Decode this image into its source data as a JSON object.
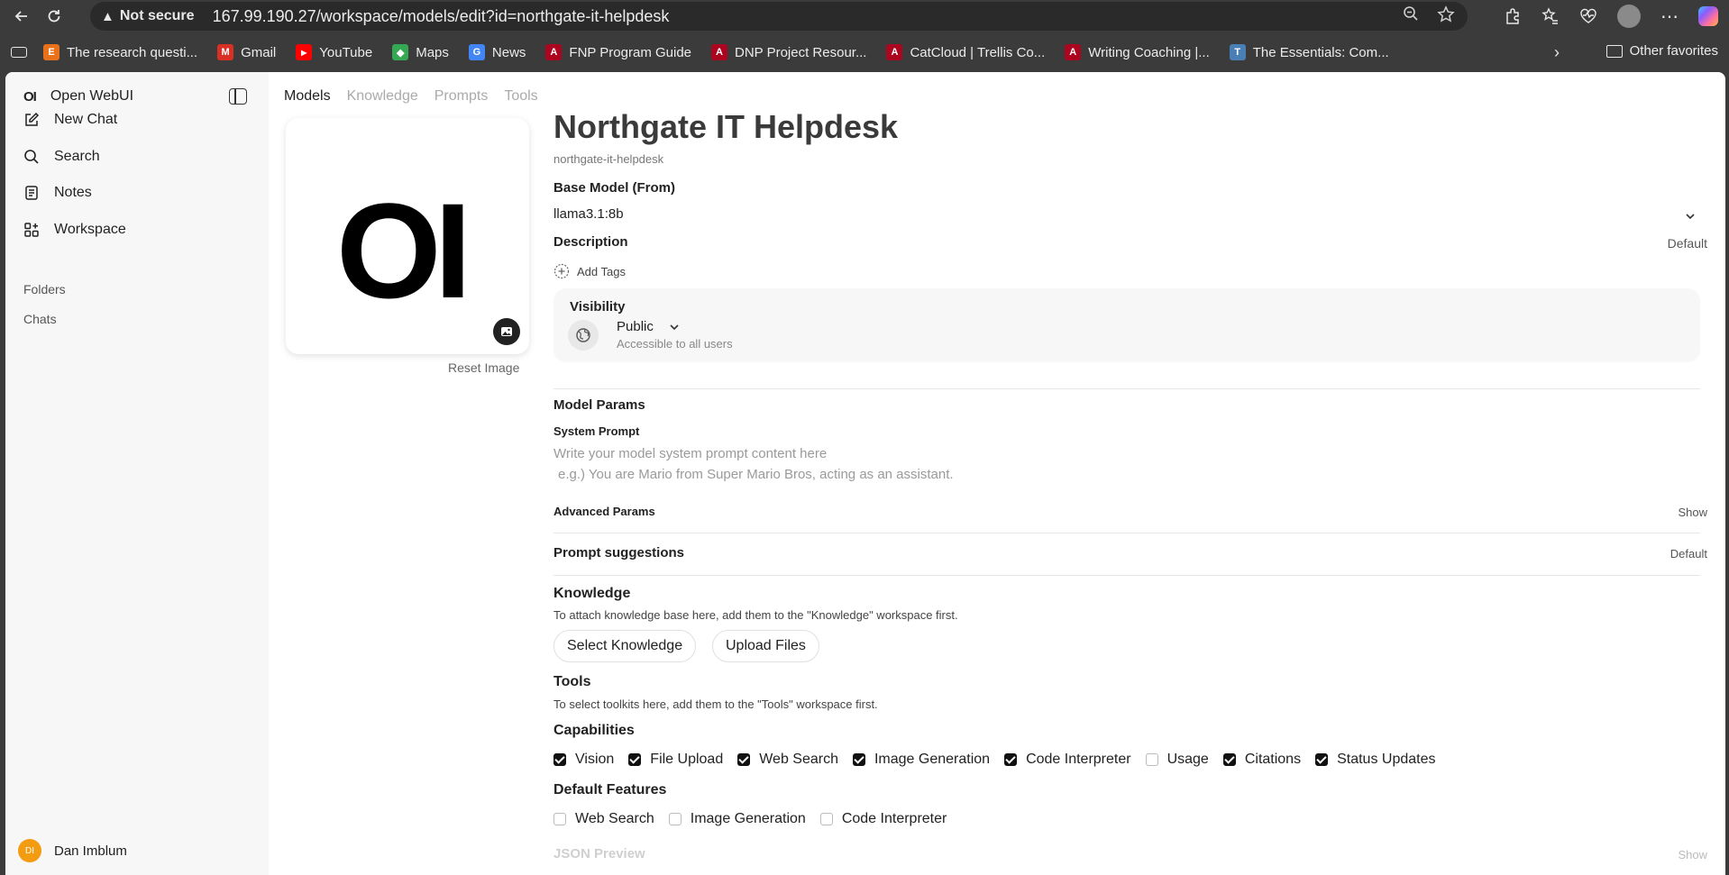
{
  "browser": {
    "not_secure": "Not secure",
    "url": "167.99.190.27/workspace/models/edit?id=northgate-it-helpdesk",
    "bookmarks": [
      {
        "label": "The research questi...",
        "color": "#e8711a",
        "glyph": "E"
      },
      {
        "label": "Gmail",
        "color": "#d93025",
        "glyph": "M"
      },
      {
        "label": "YouTube",
        "color": "#ff0000",
        "glyph": "▶"
      },
      {
        "label": "Maps",
        "color": "#34a853",
        "glyph": "◆"
      },
      {
        "label": "News",
        "color": "#4285f4",
        "glyph": "G"
      },
      {
        "label": "FNP Program Guide",
        "color": "#ab0520",
        "glyph": "A"
      },
      {
        "label": "DNP Project Resour...",
        "color": "#ab0520",
        "glyph": "A"
      },
      {
        "label": "CatCloud | Trellis Co...",
        "color": "#ab0520",
        "glyph": "A"
      },
      {
        "label": "Writing Coaching |...",
        "color": "#ab0520",
        "glyph": "A"
      },
      {
        "label": "The Essentials: Com...",
        "color": "#4a7fb5",
        "glyph": "T"
      }
    ],
    "other_favorites": "Other favorites"
  },
  "sidebar": {
    "brand": "Open WebUI",
    "brand_logo": "OI",
    "items": [
      {
        "label": "New Chat",
        "icon": "pencil-square-icon"
      },
      {
        "label": "Search",
        "icon": "search-icon"
      },
      {
        "label": "Notes",
        "icon": "notes-icon"
      },
      {
        "label": "Workspace",
        "icon": "grid-icon"
      }
    ],
    "folders": "Folders",
    "chats": "Chats",
    "user": {
      "initials": "DI",
      "name": "Dan Imblum"
    }
  },
  "tabs": [
    "Models",
    "Knowledge",
    "Prompts",
    "Tools"
  ],
  "model": {
    "logo_text": "OI",
    "reset_image": "Reset Image",
    "name": "Northgate IT Helpdesk",
    "id": "northgate-it-helpdesk",
    "base_model_label": "Base Model (From)",
    "base_model": "llama3.1:8b",
    "description_label": "Description",
    "description_value": "Default",
    "add_tags": "Add Tags",
    "visibility_label": "Visibility",
    "visibility_value": "Public",
    "visibility_sub": "Accessible to all users",
    "model_params": "Model Params",
    "system_prompt_label": "System Prompt",
    "system_prompt_placeholder_1": "Write your model system prompt content here",
    "system_prompt_placeholder_2": "e.g.) You are Mario from Super Mario Bros, acting as an assistant.",
    "advanced_params": "Advanced Params",
    "advanced_show": "Show",
    "prompt_suggestions": "Prompt suggestions",
    "prompt_suggestions_value": "Default",
    "knowledge_label": "Knowledge",
    "knowledge_help": "To attach knowledge base here, add them to the \"Knowledge\" workspace first.",
    "select_knowledge": "Select Knowledge",
    "upload_files": "Upload Files",
    "tools_label": "Tools",
    "tools_help": "To select toolkits here, add them to the \"Tools\" workspace first.",
    "capabilities_label": "Capabilities",
    "capabilities": [
      {
        "label": "Vision",
        "checked": true
      },
      {
        "label": "File Upload",
        "checked": true
      },
      {
        "label": "Web Search",
        "checked": true
      },
      {
        "label": "Image Generation",
        "checked": true
      },
      {
        "label": "Code Interpreter",
        "checked": true
      },
      {
        "label": "Usage",
        "checked": false
      },
      {
        "label": "Citations",
        "checked": true
      },
      {
        "label": "Status Updates",
        "checked": true
      }
    ],
    "default_features_label": "Default Features",
    "default_features": [
      {
        "label": "Web Search",
        "checked": false
      },
      {
        "label": "Image Generation",
        "checked": false
      },
      {
        "label": "Code Interpreter",
        "checked": false
      }
    ],
    "json_preview": "JSON Preview",
    "json_show": "Show"
  }
}
